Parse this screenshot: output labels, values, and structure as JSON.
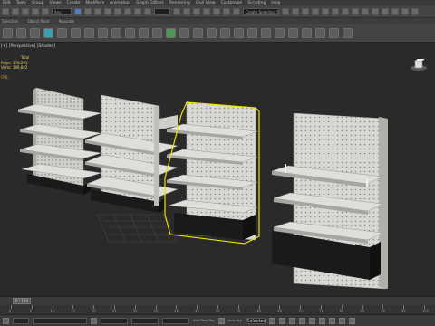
{
  "menu": [
    "Edit",
    "Tools",
    "Group",
    "Views",
    "Create",
    "Modifiers",
    "Animation",
    "Graph Editors",
    "Rendering",
    "Civil View",
    "Customize",
    "Scripting",
    "Help"
  ],
  "toolbar": {
    "filter_value": "Any",
    "selection_set_placeholder": "Create Selection Se"
  },
  "ribbon": [
    "Selection",
    "Object Paint",
    "Populate"
  ],
  "viewport": {
    "label": "[+] [Perspective] [Shaded]",
    "stats_header": "Total",
    "polys_label": "Polys:",
    "polys_value": "178,291",
    "verts_label": "Verts:",
    "verts_value": "189,822",
    "fps_label": "FPS:"
  },
  "timeline": {
    "frame_display": "0 / 100",
    "ticks": [
      "0",
      "5",
      "10",
      "15",
      "20",
      "25",
      "30",
      "35",
      "40",
      "45",
      "50",
      "55",
      "60",
      "65",
      "70",
      "75",
      "80",
      "85",
      "90",
      "95",
      "100"
    ]
  },
  "status": {
    "add_time_tag": "Add Time Tag",
    "auto_key": "Auto Key",
    "selected": "Selected"
  },
  "colors": {
    "selection_outline": "#e8e000",
    "stats_yellow": "#e9d36a",
    "stats_orange": "#e59b45",
    "viewport_bg": "#2a2a2a"
  }
}
